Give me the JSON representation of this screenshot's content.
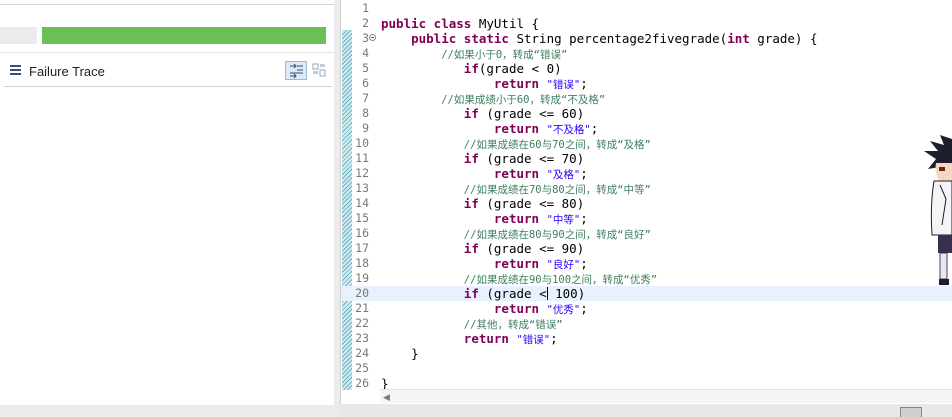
{
  "junit_panel": {
    "progress": 1.0,
    "progress_color": "#6bbf59",
    "failure_trace_title": "Failure Trace",
    "icons": [
      "list-icon",
      "filter-stack-icon",
      "compare-icon"
    ]
  },
  "editor": {
    "current_line": 20,
    "lines": [
      {
        "n": "1",
        "segments": []
      },
      {
        "n": "2",
        "segments": [
          [
            "kw",
            "public class"
          ],
          [
            "pl",
            " MyUtil {"
          ]
        ]
      },
      {
        "n": "3",
        "fold": true,
        "segments": [
          [
            "pl",
            "    "
          ],
          [
            "kw",
            "public static"
          ],
          [
            "pl",
            " String percentage2fivegrade("
          ],
          [
            "kw",
            "int"
          ],
          [
            "pl",
            " grade) {"
          ]
        ]
      },
      {
        "n": "4",
        "segments": [
          [
            "pl",
            "        "
          ],
          [
            "cm",
            "//如果小于0，转成“错误”"
          ]
        ]
      },
      {
        "n": "5",
        "segments": [
          [
            "pl",
            "           "
          ],
          [
            "kw",
            "if"
          ],
          [
            "pl",
            "(grade < 0)"
          ]
        ]
      },
      {
        "n": "6",
        "segments": [
          [
            "pl",
            "               "
          ],
          [
            "kw",
            "return"
          ],
          [
            "pl",
            " "
          ],
          [
            "st",
            "\"错误\""
          ],
          [
            "pl",
            ";"
          ]
        ]
      },
      {
        "n": "7",
        "segments": [
          [
            "pl",
            "        "
          ],
          [
            "cm",
            "//如果成绩小于60，转成“不及格”"
          ]
        ]
      },
      {
        "n": "8",
        "segments": [
          [
            "pl",
            "           "
          ],
          [
            "kw",
            "if"
          ],
          [
            "pl",
            " (grade <= 60)"
          ]
        ]
      },
      {
        "n": "9",
        "segments": [
          [
            "pl",
            "               "
          ],
          [
            "kw",
            "return"
          ],
          [
            "pl",
            " "
          ],
          [
            "st",
            "\"不及格\""
          ],
          [
            "pl",
            ";"
          ]
        ]
      },
      {
        "n": "10",
        "segments": [
          [
            "pl",
            "           "
          ],
          [
            "cm",
            "//如果成绩在60与70之间，转成“及格”"
          ]
        ]
      },
      {
        "n": "11",
        "segments": [
          [
            "pl",
            "           "
          ],
          [
            "kw",
            "if"
          ],
          [
            "pl",
            " (grade <= 70)"
          ]
        ]
      },
      {
        "n": "12",
        "segments": [
          [
            "pl",
            "               "
          ],
          [
            "kw",
            "return"
          ],
          [
            "pl",
            " "
          ],
          [
            "st",
            "\"及格\""
          ],
          [
            "pl",
            ";"
          ]
        ]
      },
      {
        "n": "13",
        "segments": [
          [
            "pl",
            "           "
          ],
          [
            "cm",
            "//如果成绩在70与80之间，转成“中等”"
          ]
        ]
      },
      {
        "n": "14",
        "segments": [
          [
            "pl",
            "           "
          ],
          [
            "kw",
            "if"
          ],
          [
            "pl",
            " (grade <= 80)"
          ]
        ]
      },
      {
        "n": "15",
        "segments": [
          [
            "pl",
            "               "
          ],
          [
            "kw",
            "return"
          ],
          [
            "pl",
            " "
          ],
          [
            "st",
            "\"中等\""
          ],
          [
            "pl",
            ";"
          ]
        ]
      },
      {
        "n": "16",
        "segments": [
          [
            "pl",
            "           "
          ],
          [
            "cm",
            "//如果成绩在80与90之间，转成“良好”"
          ]
        ]
      },
      {
        "n": "17",
        "segments": [
          [
            "pl",
            "           "
          ],
          [
            "kw",
            "if"
          ],
          [
            "pl",
            " (grade <= 90)"
          ]
        ]
      },
      {
        "n": "18",
        "segments": [
          [
            "pl",
            "               "
          ],
          [
            "kw",
            "return"
          ],
          [
            "pl",
            " "
          ],
          [
            "st",
            "\"良好\""
          ],
          [
            "pl",
            ";"
          ]
        ]
      },
      {
        "n": "19",
        "segments": [
          [
            "pl",
            "           "
          ],
          [
            "cm",
            "//如果成绩在90与100之间，转成“优秀”"
          ]
        ]
      },
      {
        "n": "20",
        "segments": [
          [
            "pl",
            "           "
          ],
          [
            "kw",
            "if"
          ],
          [
            "pl",
            " (grade <"
          ],
          [
            "caret",
            ""
          ],
          [
            "pl",
            " 100)"
          ]
        ]
      },
      {
        "n": "21",
        "segments": [
          [
            "pl",
            "               "
          ],
          [
            "kw",
            "return"
          ],
          [
            "pl",
            " "
          ],
          [
            "st",
            "\"优秀\""
          ],
          [
            "pl",
            ";"
          ]
        ]
      },
      {
        "n": "22",
        "segments": [
          [
            "pl",
            "           "
          ],
          [
            "cm",
            "//其他，转成“错误”"
          ]
        ]
      },
      {
        "n": "23",
        "segments": [
          [
            "pl",
            "           "
          ],
          [
            "kw",
            "return"
          ],
          [
            "pl",
            " "
          ],
          [
            "st",
            "\"错误\""
          ],
          [
            "pl",
            ";"
          ]
        ]
      },
      {
        "n": "24",
        "segments": [
          [
            "pl",
            "    }"
          ]
        ]
      },
      {
        "n": "25",
        "segments": []
      },
      {
        "n": "26",
        "segments": [
          [
            "pl",
            "}"
          ]
        ]
      }
    ]
  }
}
